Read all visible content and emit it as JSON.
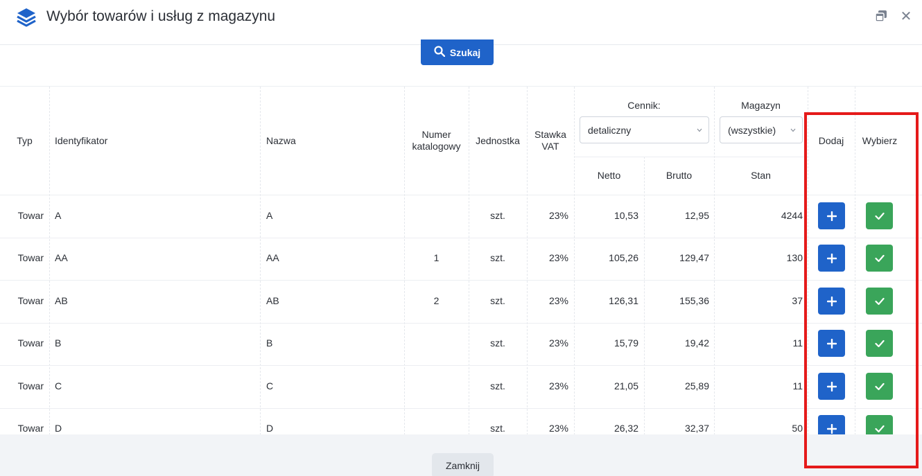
{
  "header": {
    "title": "Wybór towarów i usług z magazynu",
    "icons": [
      "layers-icon",
      "restore-window-icon",
      "close-icon"
    ],
    "close_glyph": "✕"
  },
  "search": {
    "label": "Szukaj"
  },
  "table": {
    "columns": {
      "typ": "Typ",
      "identyfikator": "Identyfikator",
      "nazwa": "Nazwa",
      "numer_katalogowy": "Numer katalogowy",
      "jednostka": "Jednostka",
      "stawka_vat": "Stawka VAT",
      "cennik": "Cennik:",
      "magazyn": "Magazyn",
      "netto": "Netto",
      "brutto": "Brutto",
      "stan": "Stan",
      "dodaj": "Dodaj",
      "wybierz": "Wybierz"
    },
    "cennik_select": "detaliczny",
    "magazyn_select": "(wszystkie)",
    "rows": [
      {
        "typ": "Towar",
        "id": "A",
        "nazwa": "A",
        "nr": "",
        "jm": "szt.",
        "vat": "23%",
        "netto": "10,53",
        "brutto": "12,95",
        "stan": "4244"
      },
      {
        "typ": "Towar",
        "id": "AA",
        "nazwa": "AA",
        "nr": "1",
        "jm": "szt.",
        "vat": "23%",
        "netto": "105,26",
        "brutto": "129,47",
        "stan": "130"
      },
      {
        "typ": "Towar",
        "id": "AB",
        "nazwa": "AB",
        "nr": "2",
        "jm": "szt.",
        "vat": "23%",
        "netto": "126,31",
        "brutto": "155,36",
        "stan": "37"
      },
      {
        "typ": "Towar",
        "id": "B",
        "nazwa": "B",
        "nr": "",
        "jm": "szt.",
        "vat": "23%",
        "netto": "15,79",
        "brutto": "19,42",
        "stan": "11"
      },
      {
        "typ": "Towar",
        "id": "C",
        "nazwa": "C",
        "nr": "",
        "jm": "szt.",
        "vat": "23%",
        "netto": "21,05",
        "brutto": "25,89",
        "stan": "11"
      },
      {
        "typ": "Towar",
        "id": "D",
        "nazwa": "D",
        "nr": "",
        "jm": "szt.",
        "vat": "23%",
        "netto": "26,32",
        "brutto": "32,37",
        "stan": "50"
      }
    ]
  },
  "footer": {
    "close_label": "Zamknij"
  },
  "colors": {
    "primary": "#1f63c9",
    "success": "#3aa55a",
    "highlight": "#e51a1a"
  }
}
